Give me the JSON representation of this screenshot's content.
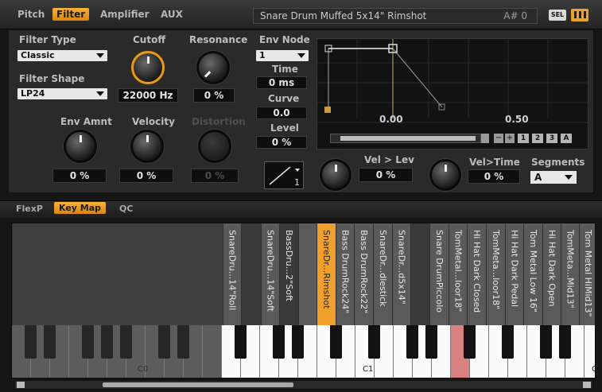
{
  "top_tabs": [
    "Pitch",
    "Filter",
    "Amplifier",
    "AUX"
  ],
  "active_top_tab": "Filter",
  "preset": {
    "name": "Snare Drum Muffed 5x14\" Rimshot",
    "note": "A# 0"
  },
  "sel_button": "SEL",
  "filter": {
    "type_label": "Filter Type",
    "type_value": "Classic",
    "shape_label": "Filter Shape",
    "shape_value": "LP24",
    "cutoff_label": "Cutoff",
    "cutoff_value": "22000 Hz",
    "resonance_label": "Resonance",
    "resonance_value": "0 %",
    "env_amnt_label": "Env Amnt",
    "env_amnt_value": "0 %",
    "velocity_label": "Velocity",
    "velocity_value": "0 %",
    "distortion_label": "Distortion",
    "distortion_value": "0 %"
  },
  "envelope": {
    "node_label": "Env Node",
    "node_value": "1",
    "time_label": "Time",
    "time_value": "0 ms",
    "curve_label": "Curve",
    "curve_value": "0.0",
    "level_label": "Level",
    "level_value": "0 %",
    "time_marks": [
      "0.00",
      "0.50"
    ],
    "buttons": [
      "1",
      "2",
      "3",
      "A"
    ],
    "curve_box_num": "1",
    "vel_lev_label": "Vel > Lev",
    "vel_lev_value": "0 %",
    "vel_time_label": "Vel>Time",
    "vel_time_value": "0 %",
    "segments_label": "Segments",
    "segments_value": "A"
  },
  "bottom_tabs": [
    "FlexP",
    "Key Map",
    "QC"
  ],
  "active_bottom_tab": "Key Map",
  "samples": [
    "SnareDru...14\"Roll",
    "SnareDru...14\"Soft",
    "BassDru...2\"Soft",
    "SnareDr...Rimshot",
    "Bass DrumRock24\"",
    "Bass DrumRock22\"",
    "SnareDr...dlestick",
    "SnareDr...d5x14\"",
    "Snare DrumPiccolo",
    "TomMetal...loor18\"",
    "Hi Hat Dark Closed",
    "TomMeta...loor18\"",
    "Hi Hat Dark Pedal",
    "Tom Metal Low 16\"",
    "Hi Hat Dark Open",
    "TomMeta...Mid13\"",
    "Tom Metal HiMid13\""
  ],
  "key_labels": [
    "C0",
    "C1",
    "C"
  ],
  "colors": {
    "accent": "#f0a12c",
    "pressed_key": "#d98080"
  }
}
